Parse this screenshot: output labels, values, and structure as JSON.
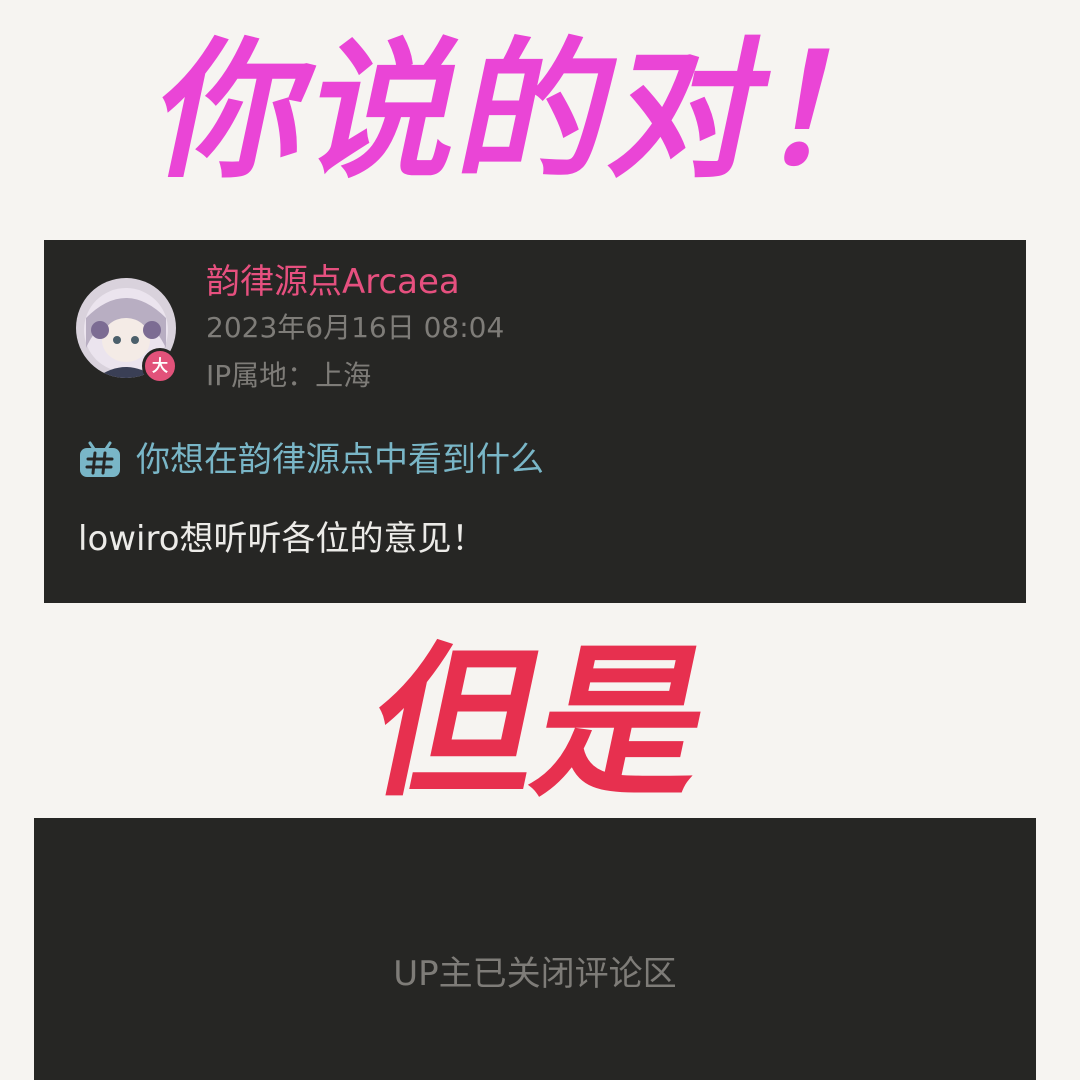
{
  "headline_top": "你说的对！",
  "headline_mid": "但是",
  "post": {
    "username": "韵律源点Arcaea",
    "timestamp": "2023年6月16日 08:04",
    "ip_location": "IP属地：上海",
    "badge": "大",
    "topic_icon": "hashtag-topic-icon",
    "topic": "你想在韵律源点中看到什么",
    "body": "lowiro想听听各位的意见！"
  },
  "comments": {
    "closed_notice": "UP主已关闭评论区"
  },
  "colors": {
    "headline_top": "#ea45d6",
    "headline_mid": "#e7304f",
    "username": "#e6507f",
    "topic": "#79b6c7",
    "card_background": "#262624",
    "page_background": "#f6f4f1"
  }
}
